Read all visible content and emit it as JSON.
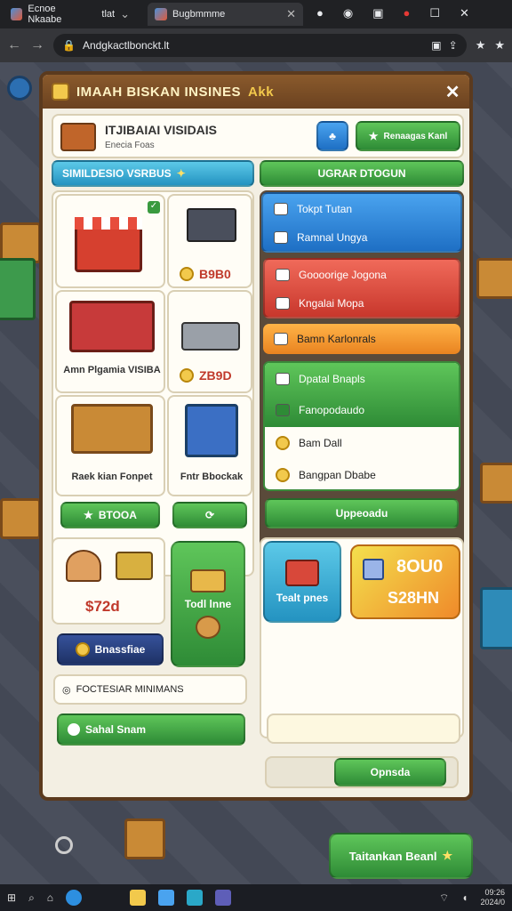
{
  "browser": {
    "tabs": [
      {
        "label": "Ecnoe Nkaabe"
      },
      {
        "label": "Bugbmmme"
      }
    ],
    "tab_extra": "tlat",
    "url": "Andgkactlbonckt.lt"
  },
  "modal": {
    "title": "IMAAH BISKAN INSINES",
    "title_badge": "Akk",
    "header_card": {
      "title": "ITJIBAIAI VISIDAIS",
      "subtitle": "Enecia Foas"
    },
    "header_btn": "Renaagas Kanl",
    "left_tab": "SIMILDESIO VSRBUS",
    "right_tab": "UGRAR DTOGUN",
    "items": [
      {
        "label": ""
      },
      {
        "price": "B9B0"
      },
      {
        "label": "Amn Plgamia VISIBA"
      },
      {
        "price": "ZB9D"
      },
      {
        "label": "Raek kian Fonpet"
      },
      {
        "label": "Fntr Bbockak"
      }
    ],
    "buy_btn": "BTOOA",
    "menu": [
      {
        "label": "Tokpt Tutan"
      },
      {
        "label": "Ramnal Ungya"
      },
      {
        "label": "Goooorige Jogona"
      },
      {
        "label": "Kngalai Mopa"
      },
      {
        "label": "Bamn Karlonrals"
      },
      {
        "label": "Dpatal Bnapls"
      },
      {
        "label": "Fanopodaudo"
      },
      {
        "label": "Bam Dall"
      },
      {
        "label": "Bangpan Dbabe"
      }
    ],
    "upgrade_btn": "Uppeoadu",
    "bottom_left": {
      "price": "$72d",
      "btn": "Bnassfiae",
      "green_card": "Todl lnne",
      "stat": "FOCTESIAR MINIMANS",
      "bar": "Sahal Snam"
    },
    "bottom_right": {
      "basket": "Tealt pnes",
      "value_top": "8OU0",
      "value_bottom": "S28HN",
      "btn": "Opnsda"
    }
  },
  "game": {
    "cta_btn": "Taitankan Beanl",
    "cta_icon": "star-icon"
  },
  "taskbar": {
    "time": "09:26",
    "date": "2024/0"
  }
}
